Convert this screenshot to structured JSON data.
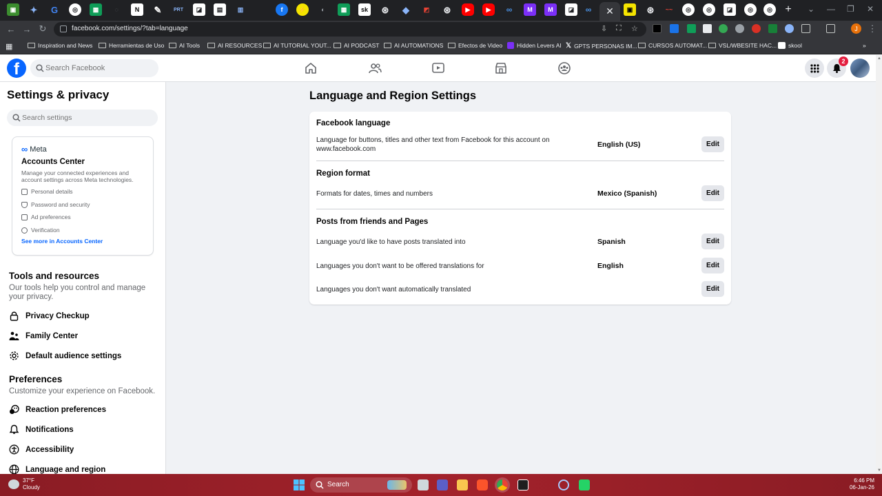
{
  "browser": {
    "url": "facebook.com/settings/?tab=language",
    "close_tab_glyph": "✕",
    "new_tab_glyph": "+",
    "profile_initial": "J",
    "bookmarks": [
      {
        "label": "Inspiration and News",
        "icon": "folder-icon"
      },
      {
        "label": "Herramientas de Uso",
        "icon": "folder-icon"
      },
      {
        "label": "AI Tools",
        "icon": "folder-icon"
      },
      {
        "label": "AI RESOURCES",
        "icon": "folder-icon"
      },
      {
        "label": "AI TUTORIAL YOUT...",
        "icon": "folder-icon"
      },
      {
        "label": "AI PODCAST",
        "icon": "folder-icon"
      },
      {
        "label": "AI AUTOMATIONS",
        "icon": "folder-icon"
      },
      {
        "label": "Efectos de Video",
        "icon": "folder-icon"
      },
      {
        "label": "Hidden Levers AI",
        "icon": "site-icon"
      },
      {
        "label": "GPTS PERSONAS IM...",
        "icon": "x-icon"
      },
      {
        "label": "CURSOS AUTOMAT...",
        "icon": "folder-icon"
      },
      {
        "label": "VSL/WBESITE HAC...",
        "icon": "folder-icon"
      },
      {
        "label": "skool",
        "icon": "skool-icon"
      }
    ]
  },
  "fb_header": {
    "logo_letter": "f",
    "search_placeholder": "Search Facebook",
    "notification_count": "2",
    "colors": {
      "brand": "#0866ff",
      "badge": "#e41e3f"
    }
  },
  "sidebar": {
    "title": "Settings & privacy",
    "search_placeholder": "Search settings",
    "accounts_center": {
      "brand": "Meta",
      "title": "Accounts Center",
      "description": "Manage your connected experiences and account settings across Meta technologies.",
      "items": [
        "Personal details",
        "Password and security",
        "Ad preferences",
        "Verification"
      ],
      "link": "See more in Accounts Center"
    },
    "tools": {
      "title": "Tools and resources",
      "description": "Our tools help you control and manage your privacy.",
      "items": [
        "Privacy Checkup",
        "Family Center",
        "Default audience settings"
      ]
    },
    "preferences": {
      "title": "Preferences",
      "description": "Customize your experience on Facebook.",
      "items": [
        "Reaction preferences",
        "Notifications",
        "Accessibility",
        "Language and region"
      ]
    }
  },
  "main": {
    "title": "Language and Region Settings",
    "sections": [
      {
        "title": "Facebook language",
        "rows": [
          {
            "label": "Language for buttons, titles and other text from Facebook for this account on www.facebook.com",
            "value": "English (US)",
            "action": "Edit"
          }
        ]
      },
      {
        "title": "Region format",
        "rows": [
          {
            "label": "Formats for dates, times and numbers",
            "value": "Mexico (Spanish)",
            "action": "Edit"
          }
        ]
      },
      {
        "title": "Posts from friends and Pages",
        "rows": [
          {
            "label": "Language you'd like to have posts translated into",
            "value": "Spanish",
            "action": "Edit"
          },
          {
            "label": "Languages you don't want to be offered translations for",
            "value": "English",
            "action": "Edit"
          },
          {
            "label": "Languages you don't want automatically translated",
            "value": "",
            "action": "Edit"
          }
        ]
      }
    ]
  },
  "taskbar": {
    "weather_temp": "37°F",
    "weather_desc": "Cloudy",
    "search_label": "Search",
    "time": "6:46 PM",
    "date": "06-Jan-26"
  }
}
